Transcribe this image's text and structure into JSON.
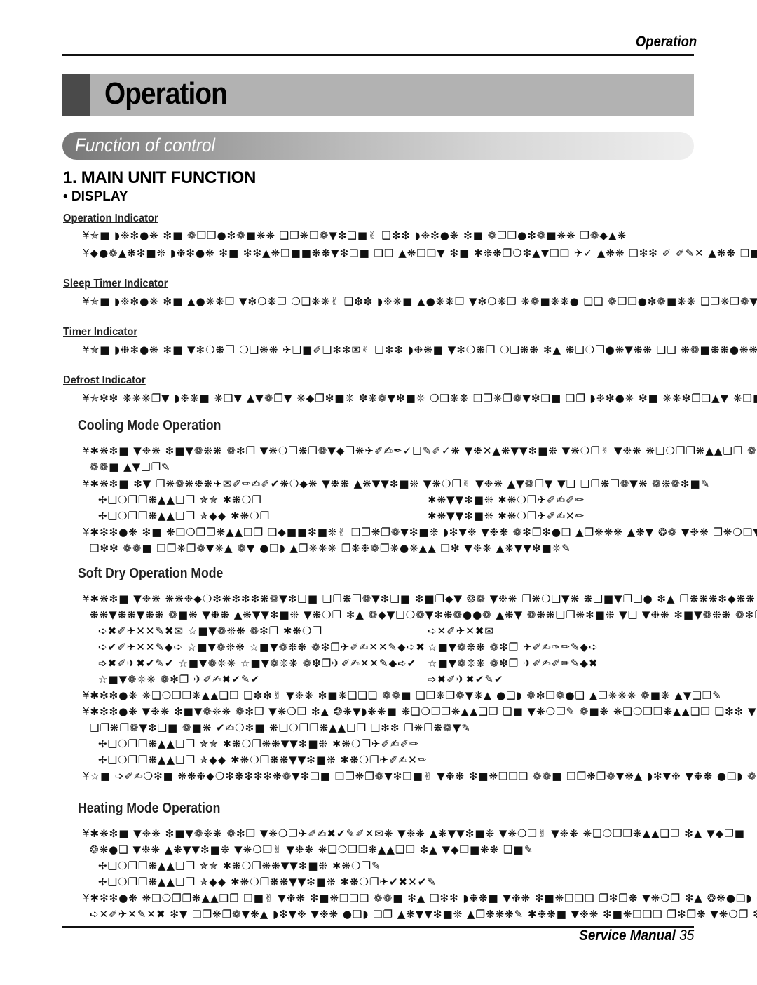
{
  "header": {
    "running_head": "Operation",
    "chapter_title": "Operation",
    "section_banner": "Function of control"
  },
  "heading": {
    "main": "1. MAIN UNIT FUNCTION",
    "sub": "• DISPLAY"
  },
  "indicators": [
    {
      "title": "Operation Indicator",
      "lines": [
        "¥✯■ ◗❉❇●❋ ❇■ ❁❐❐●❇❁■❋❋ ❑❐❋❐❁▼❇❑■✌ ❑❇❇ ◗❉❇●❋ ❇■ ❁❐❐●❇❁■❋❋ ❐❁◆▲❋",
        "¥◆●❁▲❋❇■❊ ◗❉❇●❋ ❇■ ❇❇▲❋❑■■❋❋▼❇❑■ ❑❑ ▲❋❑❑▼ ❇■ ✱❊❋❐❍❇▲▼❑❑ ✈✓ ▲❋❋ ❑❇❇ ✐ ✐✎✕ ▲❋❋ ❑■"
      ]
    },
    {
      "title": "Sleep Timer Indicator",
      "lines": [
        "¥✯■ ◗❉❇●❋ ❇■ ▲●❋❋❐ ▼❇❍❋❐ ❍❑❋❋✌ ❑❇❇ ◗❉❋■ ▲●❋❋❐ ▼❇❍❋❐ ❋❁■❋❋● ❑❑ ❁❐❐●❇❁■❋❋ ❑❐❋❐❁▼❇❑■"
      ]
    },
    {
      "title": "Timer Indicator",
      "lines": [
        "¥✯■ ◗❉❇●❋ ❇■ ▼❇❍❋❐ ❍❑❋❋ ✈❑■✐❑❇❇✉✌ ❑❇❇ ◗❉❋■ ▼❇❍❋❐ ❍❑❋❋ ❇▲ ❋❑❍❐●❋▼❋❋ ❑❑ ❋❁■❋❋●❋❋"
      ]
    },
    {
      "title": "Defrost Indicator",
      "lines": [
        "¥✯❇❇ ❋❋❋❐▼ ◗❉❋■ ❋❑▼ ▲▼❁❐▼ ❋◆❐❇■❊ ❇❋❁▼❇■❊ ❍❑❋❋ ❑❐❋❐❁▼❇❑■ ❑❐ ◗❉❇●❋ ❇■ ❋❋❇❐❑▲▼ ❋❑■▼❐"
      ]
    }
  ],
  "sections": [
    {
      "title": "Cooling Mode Operation",
      "lines": [
        {
          "indent": "b",
          "text": "¥✱❋❇■ ▼❉❋ ❇■▼❁❊❋ ❁❇❐ ▼❋❍❐❋❐❁▼◆❐❋✈✐✍✒✓❑✎✐✓❋ ▼❉✕▲❋▼▼❇■❊ ▼❋❍❐✌ ▼❉❋ ❋❑❍❐❐❋▲▲❑❐ ❁■❋ ▼"
        },
        {
          "indent": "i1",
          "text": "❁❁■ ▲▼❑❐✎"
        },
        {
          "indent": "b",
          "text": "¥✱❋❇■ ❇▼ ❐❋❁❋❉❋✈✉✐✏✍✐✔❋❍◆❋ ▼❉❋ ▲❋▼▼❇■❊ ▼❋❍❐✌ ▼❉❋ ▲▼❁❐▼ ▼❑ ❑❐❋❐❁▼❋ ❁❊❁❇■✎"
        },
        {
          "indent": "i2",
          "text": "✢❑❍❐❐❋▲▲❑❐ ✯✯ ✱❋❍❐",
          "col2": "✱❋▼▼❇■❊ ✱❋❍❐✈✐✍✐✏"
        },
        {
          "indent": "i2",
          "text": "✢❑❍❐❐❋▲▲❑❐ ✯◆◆ ✱❋❍❐",
          "col2": "✱❋▼▼❇■❊ ✱❋❍❐✈✐✍✕✏"
        },
        {
          "indent": "b",
          "text": "¥✱❇❇●❋ ❇■ ❋❑❍❐❐❋▲▲❑❐ ❑◆■■❇■❊✌ ❑❐❋❐❁▼❇■❊ ◗❇▼❉ ▼❉❋ ❁❇❐❇●❑ ▲❐❋❋❋ ▲❋▼ ❂❁ ▼❉❋ ❐❋❍❑▼❋ ❋"
        },
        {
          "indent": "i1",
          "text": "❑❇❇ ❁❁■ ❑❐❋❐❁▼❋▲ ❁▼ ●❑◗ ▲❐❋❋❋ ❐❋❉❁❐❋●❋▲▲ ❑❇ ▼❉❋ ▲❋▼▼❇■❊✎"
        }
      ]
    },
    {
      "title": "Soft Dry Operation Mode",
      "lines": [
        {
          "indent": "b",
          "text": "¥✱❋❇■ ▼❉❋ ❋❋❉◆❍❇❋❇❇❇❋❁▼❇❑■ ❑❐❋❐❁▼❇❑■ ❇■❐◆▼ ❂❁ ▼❉❋ ❐❋❍❑▼❋ ❋❑■▼❐❑● ❇▲ ❐❋❋❋❇◆❋❋✌ ▼❉"
        },
        {
          "indent": "i1",
          "text": "❋❋▼❋❋▼❋❋ ❁■❋ ▼❉❋ ▲❋▼▼❇■❊ ▼❋❍❐ ❇▲ ❁◆▼❑❍❁▼❇❋❁●●❁ ▲❋▼ ❁❋❋❑❐❋❇■❊ ▼❑ ▼❉❋ ❇■▼❁❊❋ ❁❇❐"
        },
        {
          "indent": "i2",
          "text": "➪✖✐✈✕✕✎✖✉  ☆■▼❁❊❋ ❁❇❐ ✱❋❍❐",
          "col2": "➪✕✐✈✕✖✉"
        },
        {
          "indent": "i2",
          "text": "➪✔✐✈✕✕✎◆➪  ☆■▼❁❊❋ ☆■▼❁❊❋ ❁❇❐✈✐✍✕✕✎◆➪✖",
          "col2": "☆■▼❁❊❋ ❁❇❐ ✈✐✍✑✏✎◆➪"
        },
        {
          "indent": "i2",
          "text": "➩✖✐✈✖✔✎✔  ☆■▼❁❊❋ ☆■▼❁❊❋ ❁❇❐✈✐✍✕✕✎◆➪✔",
          "col2": "☆■▼❁❊❋ ❁❇❐ ✈✐✍✐✏✎◆✖"
        },
        {
          "indent": "i2",
          "text": "☆■▼❁❊❋ ❁❇❐ ✈✐✍✖✔✎✔",
          "col2": "➩✖✐✈✖✔✎✔"
        },
        {
          "indent": "b",
          "text": "¥✱❇❇●❋ ❋❑❍❐❐❋▲▲❑❐ ❑❇❇✌ ▼❉❋ ❇■❋❑❑❑ ❁❁■ ❑❐❋❐❁▼❋▲ ●❑◗ ❁❇❐❁●❑ ▲❐❋❋❋ ❁■❋ ▲▼❑❐✎"
        },
        {
          "indent": "b",
          "text": "¥✱❇❇●❋ ▼❉❋ ❇■▼❁❊❋ ❁❇❐ ▼❋❍❐ ❇▲ ❂❋▼◗❋❋■ ❋❑❍❐❐❋▲▲❑❐ ❑■ ▼❋❍❐✎ ❁■❋ ❋❑❍❐❐❋▲▲❑❐ ❑❇❇ ▼"
        },
        {
          "indent": "i1",
          "text": "❑❐❋❐❁▼❇❑■ ❁■❋ ✔✍❍❇■ ❋❑❍❐❐❋▲▲❑❐ ❑❇❇ ❐❋❐❋❁▼✎"
        },
        {
          "indent": "i2",
          "text": "✢❑❍❐❐❋▲▲❑❐ ✯✯ ✱❋❍❐❋❋▼▼❇■❊ ✱❋❍❐✈✐✍✐✏"
        },
        {
          "indent": "i2",
          "text": "✢❑❍❐❐❋▲▲❑❐ ✯◆◆ ✱❋❍❐❋❋▼▼❇■❊ ✱❋❍❐✈✐✍✕✏"
        },
        {
          "indent": "b",
          "text": "¥☆■ ➩✐✍❍❇■ ❋❋❉◆❍❇❋❇❇❇❋❁▼❇❑■ ❑❐❋❐❁▼❇❑■✌ ▼❉❋ ❇■❋❑❑❑ ❁❁■ ❑❐❋❐❁▼❋▲ ◗❇▼❉ ▼❉❋ ●❑◗ ❁❇❐"
        }
      ]
    },
    {
      "title": "Heating Mode Operation",
      "lines": [
        {
          "indent": "b",
          "text": "¥✱❋❇■ ▼❉❋ ❇■▼❁❊❋ ❁❇❐ ▼❋❍❐✈✐✍✖✔✎✐✕✉❋ ▼❉❋ ▲❋▼▼❇■❊ ▼❋❍❐✌ ▼❉❋ ❋❑❍❐❐❋▲▲❑❐ ❇▲ ▼◆❐■"
        },
        {
          "indent": "i1",
          "text": "❂❋●❑ ▼❉❋ ▲❋▼▼❇■❊ ▼❋❍❐✌ ▼❉❋ ❋❑❍❐❐❋▲▲❑❐ ❇▲ ▼◆❐■❋❋ ❑■✎"
        },
        {
          "indent": "i2",
          "text": "✢❑❍❐❐❋▲▲❑❐ ✯✯ ✱❋❍❐❋❋▼▼❇■❊ ✱❋❍❐✎"
        },
        {
          "indent": "i2",
          "text": "✢❑❍❐❐❋▲▲❑❐ ✯◆◆ ✱❋❍❐❋❋▼▼❇■❊ ✱❋❍❐✈✔✖✕✔✎"
        },
        {
          "indent": "b",
          "text": "¥✱❇❇●❋ ❋❑❍❐❐❋▲▲❑❐ ❑■✌ ▼❉❋ ❇■❋❑❑❑ ❁❁■ ❇▲ ❑❇❇ ◗❉❋■ ▼❉❋ ❇■❋❑❑❑ ❐❇❐❋ ▼❋❍❐ ❇▲ ❂❋●❑◗ ➪"
        },
        {
          "indent": "i1",
          "text": "➪✕✐✈✕✎✕✖ ❇▼ ❑❐❋❐❁▼❋▲ ◗❇▼❉ ▼❉❋ ●❑◗ ❑❐ ▲❋▼▼❇■❊ ▲❐❋❋❋✎ ✱❉❋■ ▼❉❋ ❇■❋❑❑❑ ❐❇❐❋ ▼❋❍❐ ❇"
        }
      ]
    }
  ],
  "footer": {
    "manual_label": "Service Manual",
    "page_number": "35"
  }
}
